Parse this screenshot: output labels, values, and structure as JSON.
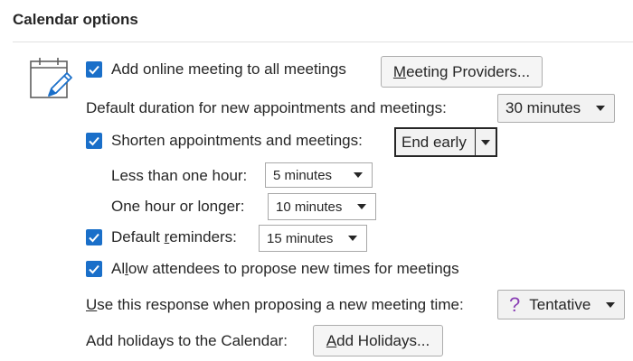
{
  "section": {
    "title": "Calendar options"
  },
  "icons": {
    "calendar": "calendar-pencil-icon",
    "checkbox": "checkmark-icon",
    "tentative": "question-mark-icon"
  },
  "colors": {
    "checkbox": "#1a6fc9",
    "tentative_icon": "#8a3fb5"
  },
  "online_meeting": {
    "label": "Add online meeting to all meetings",
    "checked": true,
    "providers_button_prefix": "M",
    "providers_button_rest": "eeting Providers..."
  },
  "default_duration": {
    "label": "Default duration for new appointments and meetings:",
    "value": "30 minutes"
  },
  "shorten": {
    "label": "Shorten appointments and meetings:",
    "checked": true,
    "mode_value": "End early",
    "less_than_hour": {
      "label": "Less than one hour:",
      "value": "5 minutes"
    },
    "hour_or_longer": {
      "label": "One hour or longer:",
      "value": "10 minutes"
    }
  },
  "reminders": {
    "label_before": "Default ",
    "label_underlined": "r",
    "label_after": "eminders:",
    "checked": true,
    "value": "15 minutes"
  },
  "propose_times": {
    "label_before": "Al",
    "label_underlined": "l",
    "label_after": "ow attendees to propose new times for meetings",
    "checked": true
  },
  "response": {
    "label_underlined": "U",
    "label_after": "se this response when proposing a new meeting time:",
    "value": "Tentative",
    "icon_glyph": "?"
  },
  "holidays": {
    "label": "Add holidays to the Calendar:",
    "button_prefix": "A",
    "button_rest": "dd Holidays..."
  }
}
